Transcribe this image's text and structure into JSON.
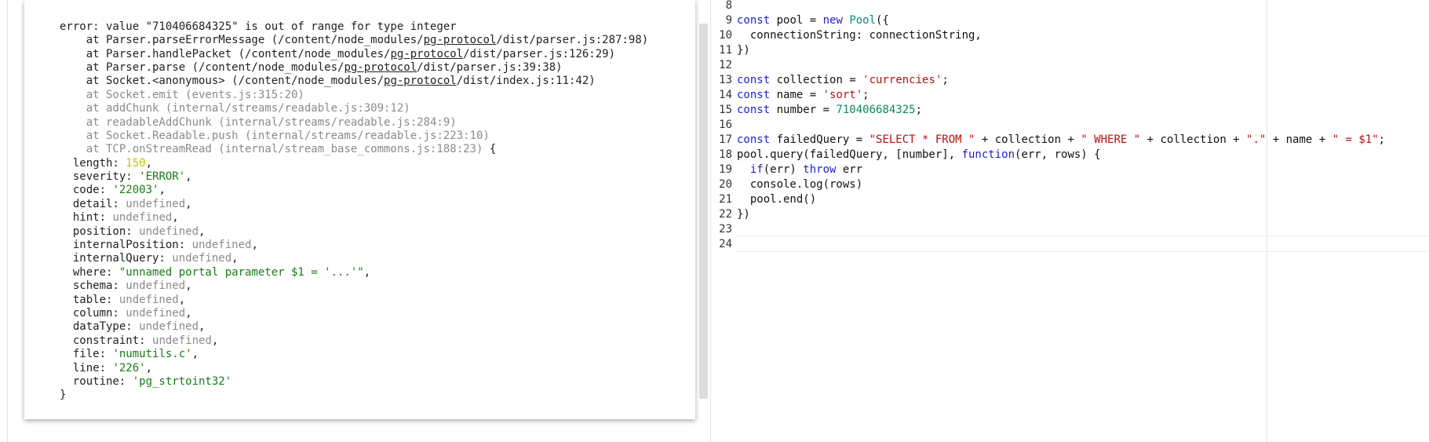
{
  "output": {
    "lines": [
      {
        "segments": [
          {
            "t": "     ^",
            "c": ""
          }
        ]
      },
      {
        "segments": [
          {
            "t": "",
            "c": ""
          }
        ]
      },
      {
        "segments": [
          {
            "t": "error: value \"710406684325\" is out of range for type integer",
            "c": ""
          }
        ]
      },
      {
        "segments": [
          {
            "t": "    at Parser.parseErrorMessage (/content/node_modules/",
            "c": ""
          },
          {
            "t": "pg-protocol",
            "c": "u"
          },
          {
            "t": "/dist/parser.js:287:98)",
            "c": ""
          }
        ]
      },
      {
        "segments": [
          {
            "t": "    at Parser.handlePacket (/content/node_modules/",
            "c": ""
          },
          {
            "t": "pg-protocol",
            "c": "u"
          },
          {
            "t": "/dist/parser.js:126:29)",
            "c": ""
          }
        ]
      },
      {
        "segments": [
          {
            "t": "    at Parser.parse (/content/node_modules/",
            "c": ""
          },
          {
            "t": "pg-protocol",
            "c": "u"
          },
          {
            "t": "/dist/parser.js:39:38)",
            "c": ""
          }
        ]
      },
      {
        "segments": [
          {
            "t": "    at Socket.<anonymous> (/content/node_modules/",
            "c": ""
          },
          {
            "t": "pg-protocol",
            "c": "u"
          },
          {
            "t": "/dist/index.js:11:42)",
            "c": ""
          }
        ]
      },
      {
        "segments": [
          {
            "t": "    at Socket.emit (events.js:315:20)",
            "c": "dim"
          }
        ]
      },
      {
        "segments": [
          {
            "t": "    at addChunk (internal/streams/readable.js:309:12)",
            "c": "dim"
          }
        ]
      },
      {
        "segments": [
          {
            "t": "    at readableAddChunk (internal/streams/readable.js:284:9)",
            "c": "dim"
          }
        ]
      },
      {
        "segments": [
          {
            "t": "    at Socket.Readable.push (internal/streams/readable.js:223:10)",
            "c": "dim"
          }
        ]
      },
      {
        "segments": [
          {
            "t": "    at TCP.onStreamRead (internal/stream_base_commons.js:188:23)",
            "c": "dim"
          },
          {
            "t": " {",
            "c": ""
          }
        ]
      },
      {
        "segments": [
          {
            "t": "  length: ",
            "c": ""
          },
          {
            "t": "150",
            "c": "num"
          },
          {
            "t": ",",
            "c": ""
          }
        ]
      },
      {
        "segments": [
          {
            "t": "  severity: ",
            "c": ""
          },
          {
            "t": "'ERROR'",
            "c": "str"
          },
          {
            "t": ",",
            "c": ""
          }
        ]
      },
      {
        "segments": [
          {
            "t": "  code: ",
            "c": ""
          },
          {
            "t": "'22003'",
            "c": "str"
          },
          {
            "t": ",",
            "c": ""
          }
        ]
      },
      {
        "segments": [
          {
            "t": "  detail: ",
            "c": ""
          },
          {
            "t": "undefined",
            "c": "dim"
          },
          {
            "t": ",",
            "c": ""
          }
        ]
      },
      {
        "segments": [
          {
            "t": "  hint: ",
            "c": ""
          },
          {
            "t": "undefined",
            "c": "dim"
          },
          {
            "t": ",",
            "c": ""
          }
        ]
      },
      {
        "segments": [
          {
            "t": "  position: ",
            "c": ""
          },
          {
            "t": "undefined",
            "c": "dim"
          },
          {
            "t": ",",
            "c": ""
          }
        ]
      },
      {
        "segments": [
          {
            "t": "  internalPosition: ",
            "c": ""
          },
          {
            "t": "undefined",
            "c": "dim"
          },
          {
            "t": ",",
            "c": ""
          }
        ]
      },
      {
        "segments": [
          {
            "t": "  internalQuery: ",
            "c": ""
          },
          {
            "t": "undefined",
            "c": "dim"
          },
          {
            "t": ",",
            "c": ""
          }
        ]
      },
      {
        "segments": [
          {
            "t": "  where: ",
            "c": ""
          },
          {
            "t": "\"unnamed portal parameter $1 = '...'\"",
            "c": "str"
          },
          {
            "t": ",",
            "c": ""
          }
        ]
      },
      {
        "segments": [
          {
            "t": "  schema: ",
            "c": ""
          },
          {
            "t": "undefined",
            "c": "dim"
          },
          {
            "t": ",",
            "c": ""
          }
        ]
      },
      {
        "segments": [
          {
            "t": "  table: ",
            "c": ""
          },
          {
            "t": "undefined",
            "c": "dim"
          },
          {
            "t": ",",
            "c": ""
          }
        ]
      },
      {
        "segments": [
          {
            "t": "  column: ",
            "c": ""
          },
          {
            "t": "undefined",
            "c": "dim"
          },
          {
            "t": ",",
            "c": ""
          }
        ]
      },
      {
        "segments": [
          {
            "t": "  dataType: ",
            "c": ""
          },
          {
            "t": "undefined",
            "c": "dim"
          },
          {
            "t": ",",
            "c": ""
          }
        ]
      },
      {
        "segments": [
          {
            "t": "  constraint: ",
            "c": ""
          },
          {
            "t": "undefined",
            "c": "dim"
          },
          {
            "t": ",",
            "c": ""
          }
        ]
      },
      {
        "segments": [
          {
            "t": "  file: ",
            "c": ""
          },
          {
            "t": "'numutils.c'",
            "c": "str"
          },
          {
            "t": ",",
            "c": ""
          }
        ]
      },
      {
        "segments": [
          {
            "t": "  line: ",
            "c": ""
          },
          {
            "t": "'226'",
            "c": "str"
          },
          {
            "t": ",",
            "c": ""
          }
        ]
      },
      {
        "segments": [
          {
            "t": "  routine: ",
            "c": ""
          },
          {
            "t": "'pg_strtoint32'",
            "c": "str"
          }
        ]
      },
      {
        "segments": [
          {
            "t": "}",
            "c": ""
          }
        ]
      }
    ]
  },
  "editor": {
    "lines": [
      {
        "num": "8",
        "segments": []
      },
      {
        "num": "9",
        "segments": [
          {
            "t": "const",
            "c": "kw"
          },
          {
            "t": " pool = ",
            "c": ""
          },
          {
            "t": "new",
            "c": "kw"
          },
          {
            "t": " ",
            "c": ""
          },
          {
            "t": "Pool",
            "c": "cls"
          },
          {
            "t": "({",
            "c": ""
          }
        ]
      },
      {
        "num": "10",
        "segments": [
          {
            "t": "  connectionString: connectionString,",
            "c": ""
          }
        ]
      },
      {
        "num": "11",
        "segments": [
          {
            "t": "})",
            "c": ""
          }
        ]
      },
      {
        "num": "12",
        "segments": []
      },
      {
        "num": "13",
        "segments": [
          {
            "t": "const",
            "c": "kw"
          },
          {
            "t": " collection = ",
            "c": ""
          },
          {
            "t": "'currencies'",
            "c": "s"
          },
          {
            "t": ";",
            "c": ""
          }
        ]
      },
      {
        "num": "14",
        "segments": [
          {
            "t": "const",
            "c": "kw"
          },
          {
            "t": " name = ",
            "c": ""
          },
          {
            "t": "'sort'",
            "c": "s"
          },
          {
            "t": ";",
            "c": ""
          }
        ]
      },
      {
        "num": "15",
        "segments": [
          {
            "t": "const",
            "c": "kw"
          },
          {
            "t": " number = ",
            "c": ""
          },
          {
            "t": "710406684325",
            "c": "n"
          },
          {
            "t": ";",
            "c": ""
          }
        ]
      },
      {
        "num": "16",
        "segments": []
      },
      {
        "num": "17",
        "segments": [
          {
            "t": "const",
            "c": "kw"
          },
          {
            "t": " failedQuery = ",
            "c": ""
          },
          {
            "t": "\"SELECT * FROM \"",
            "c": "s"
          },
          {
            "t": " + collection + ",
            "c": ""
          },
          {
            "t": "\" WHERE \"",
            "c": "s"
          },
          {
            "t": " + collection + ",
            "c": ""
          },
          {
            "t": "\".\"",
            "c": "s"
          },
          {
            "t": " + name + ",
            "c": ""
          },
          {
            "t": "\" = $1\"",
            "c": "s"
          },
          {
            "t": ";",
            "c": ""
          }
        ]
      },
      {
        "num": "18",
        "segments": [
          {
            "t": "pool.query(failedQuery, [number], ",
            "c": ""
          },
          {
            "t": "function",
            "c": "kw"
          },
          {
            "t": "(err, rows) {",
            "c": ""
          }
        ]
      },
      {
        "num": "19",
        "segments": [
          {
            "t": "  ",
            "c": ""
          },
          {
            "t": "if",
            "c": "kw"
          },
          {
            "t": "(err) ",
            "c": ""
          },
          {
            "t": "throw",
            "c": "kw"
          },
          {
            "t": " err",
            "c": ""
          }
        ]
      },
      {
        "num": "20",
        "segments": [
          {
            "t": "  console.log(rows)",
            "c": ""
          }
        ]
      },
      {
        "num": "21",
        "segments": [
          {
            "t": "  pool.end()",
            "c": ""
          }
        ]
      },
      {
        "num": "22",
        "segments": [
          {
            "t": "})",
            "c": ""
          }
        ]
      },
      {
        "num": "23",
        "segments": []
      },
      {
        "num": "24",
        "segments": []
      }
    ]
  }
}
